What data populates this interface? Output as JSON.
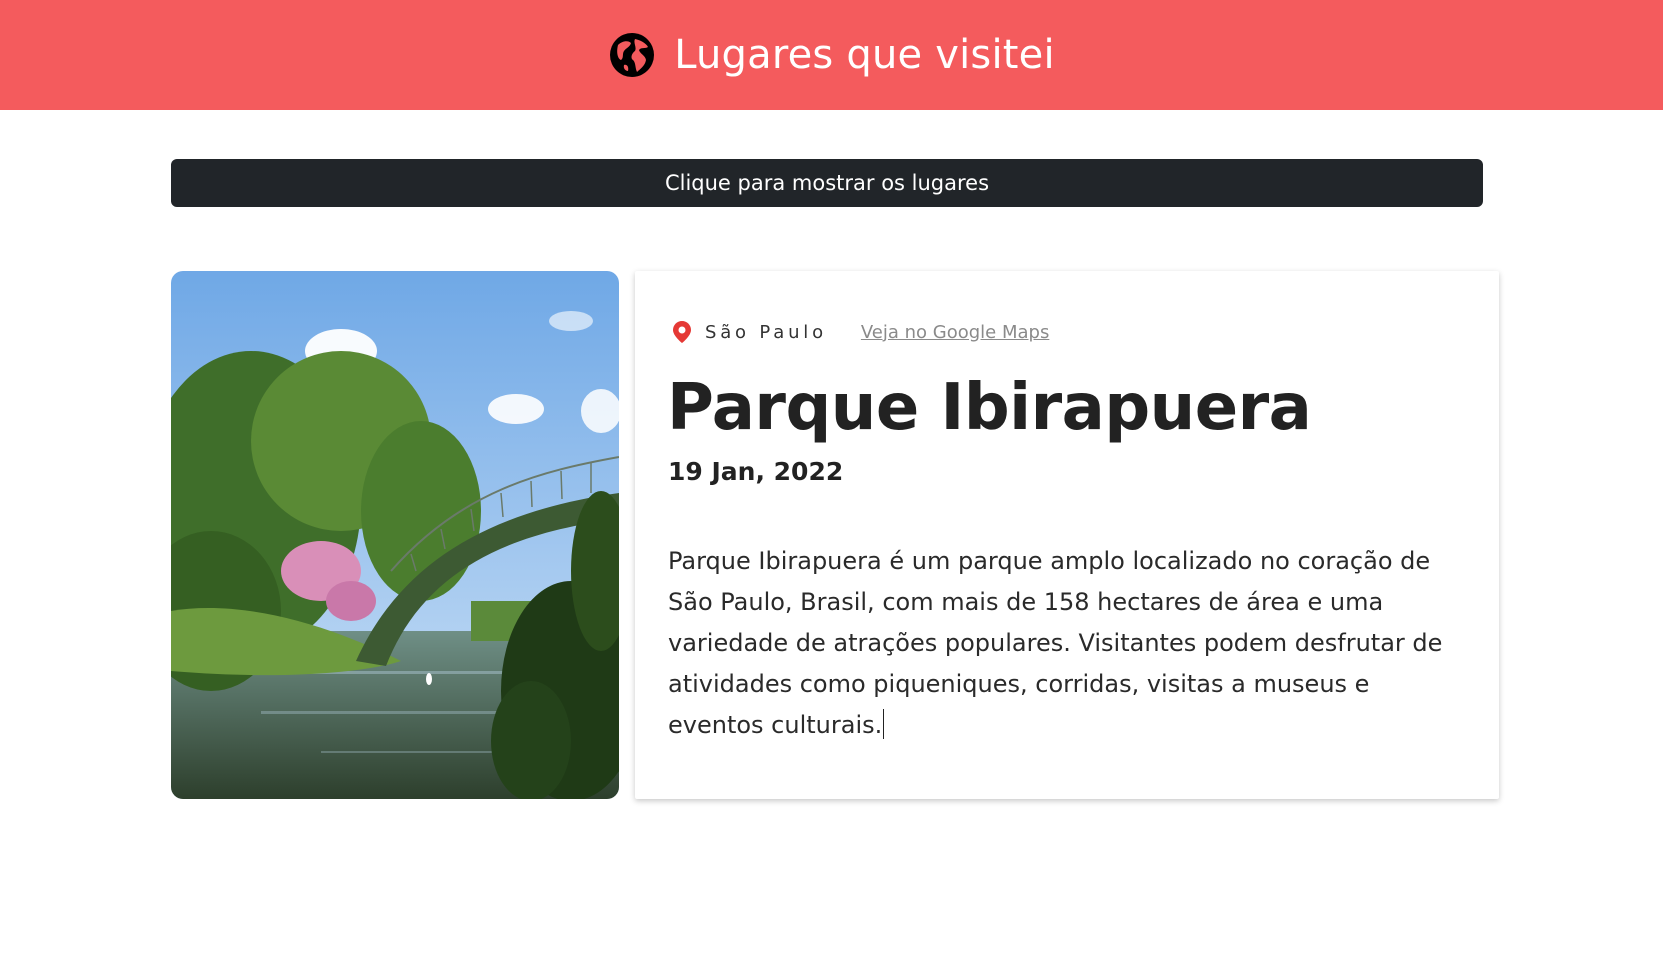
{
  "header": {
    "title": "Lugares que visitei",
    "icon": "globe-icon",
    "background": "#f45b5d"
  },
  "toggle": {
    "label": "Clique para mostrar os lugares"
  },
  "place": {
    "image_icon": "park-bridge-photo",
    "location": "São Paulo",
    "maps_link": "Veja no Google Maps",
    "name": "Parque Ibirapuera",
    "date": "19 Jan, 2022",
    "description": "Parque Ibirapuera é um parque amplo localizado no coração de São Paulo, Brasil, com mais de 158 hectares de área e uma variedade de atrações populares. Visitantes podem desfrutar de atividades como piqueniques, corridas, visitas a museus e eventos culturais."
  },
  "colors": {
    "accent": "#f45b5d",
    "button": "#212529",
    "pin": "#e53935"
  }
}
